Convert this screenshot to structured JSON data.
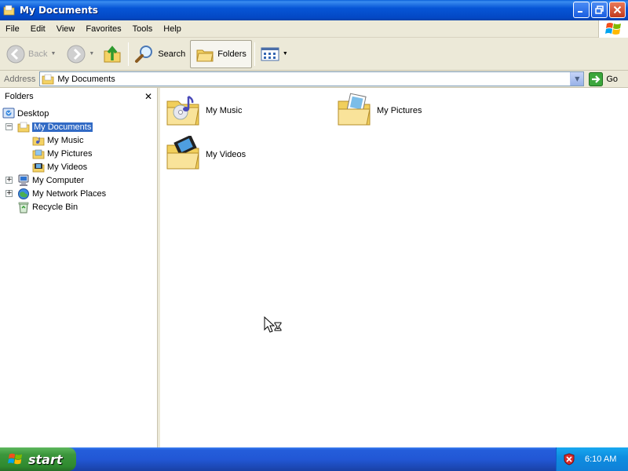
{
  "window": {
    "title": "My Documents",
    "app_icon": "folder-icon"
  },
  "menu": [
    "File",
    "Edit",
    "View",
    "Favorites",
    "Tools",
    "Help"
  ],
  "toolbar": {
    "back_label": "Back",
    "search_label": "Search",
    "folders_label": "Folders",
    "icons": {
      "back": "back-arrow-icon",
      "forward": "forward-arrow-icon",
      "up": "up-folder-icon",
      "search": "magnifier-icon",
      "folders": "folder-icon",
      "views": "views-icon"
    }
  },
  "address": {
    "label": "Address",
    "value": "My Documents",
    "go_label": "Go"
  },
  "folders_pane": {
    "title": "Folders",
    "tree": [
      {
        "label": "Desktop",
        "icon": "desktop-icon"
      },
      {
        "label": "My Documents",
        "icon": "documents-folder-icon",
        "selected": true
      },
      {
        "label": "My Music",
        "icon": "music-folder-icon"
      },
      {
        "label": "My Pictures",
        "icon": "pictures-folder-icon"
      },
      {
        "label": "My Videos",
        "icon": "videos-folder-icon"
      },
      {
        "label": "My Computer",
        "icon": "computer-icon"
      },
      {
        "label": "My Network Places",
        "icon": "network-icon"
      },
      {
        "label": "Recycle Bin",
        "icon": "recycle-bin-icon"
      }
    ]
  },
  "content": {
    "items": [
      {
        "label": "My Music",
        "icon": "music-folder-icon"
      },
      {
        "label": "My Pictures",
        "icon": "pictures-folder-icon"
      },
      {
        "label": "My Videos",
        "icon": "videos-folder-icon"
      }
    ]
  },
  "taskbar": {
    "start_label": "start",
    "clock": "6:10 AM",
    "tray_icon": "security-shield-icon"
  },
  "colors": {
    "title_bar": "#0655d6",
    "selection": "#316ac5",
    "taskbar": "#245edb",
    "start_button": "#3c963c",
    "chrome": "#ece9d8"
  }
}
